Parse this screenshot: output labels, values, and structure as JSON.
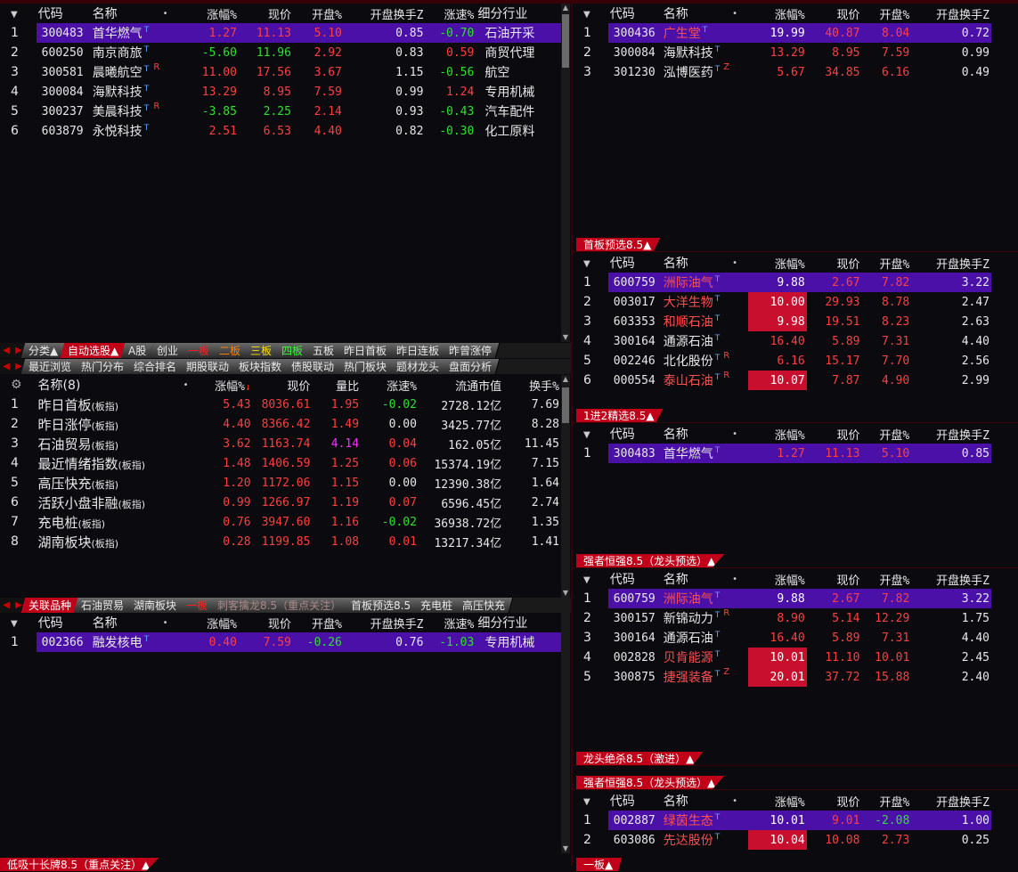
{
  "top_left": {
    "headers": [
      "代码",
      "名称",
      "•",
      "涨幅%",
      "现价",
      "开盘%",
      "开盘换手Z",
      "涨速%",
      "细分行业"
    ],
    "rows": [
      {
        "i": "1",
        "code": "300483",
        "name": "首华燃气",
        "tag": "",
        "chg": "1.27",
        "price": "11.13",
        "open": "5.10",
        "turn": "0.85",
        "speed": "-0.70",
        "ind": "石油开采",
        "cc": "up",
        "pc": "up",
        "oc": "up",
        "sc": "down",
        "sel": true
      },
      {
        "i": "2",
        "code": "600250",
        "name": "南京商旅",
        "tag": "",
        "chg": "-5.60",
        "price": "11.96",
        "open": "2.92",
        "turn": "0.83",
        "speed": "0.59",
        "ind": "商贸代理",
        "cc": "down",
        "pc": "down",
        "oc": "up",
        "sc": "up"
      },
      {
        "i": "3",
        "code": "300581",
        "name": "晨曦航空",
        "tag": "R",
        "chg": "11.00",
        "price": "17.56",
        "open": "3.67",
        "turn": "1.15",
        "speed": "-0.56",
        "ind": "航空",
        "cc": "up",
        "pc": "up",
        "oc": "up",
        "sc": "down"
      },
      {
        "i": "4",
        "code": "300084",
        "name": "海默科技",
        "tag": "",
        "chg": "13.29",
        "price": "8.95",
        "open": "7.59",
        "turn": "0.99",
        "speed": "1.24",
        "ind": "专用机械",
        "cc": "up",
        "pc": "up",
        "oc": "up",
        "sc": "up"
      },
      {
        "i": "5",
        "code": "300237",
        "name": "美晨科技",
        "tag": "R",
        "chg": "-3.85",
        "price": "2.25",
        "open": "2.14",
        "turn": "0.93",
        "speed": "-0.43",
        "ind": "汽车配件",
        "cc": "down",
        "pc": "down",
        "oc": "up",
        "sc": "down"
      },
      {
        "i": "6",
        "code": "603879",
        "name": "永悦科技",
        "tag": "",
        "chg": "2.51",
        "price": "6.53",
        "open": "4.40",
        "turn": "0.82",
        "speed": "-0.30",
        "ind": "化工原料",
        "cc": "up",
        "pc": "up",
        "oc": "up",
        "sc": "down"
      }
    ]
  },
  "tabs1": [
    "分类▲",
    "自动选股▲",
    "A股",
    "创业",
    "一板",
    "二板",
    "三板",
    "四板",
    "五板",
    "昨日首板",
    "昨日连板",
    "昨曾涨停"
  ],
  "tabs2": [
    "最近浏览",
    "热门分布",
    "综合排名",
    "期股联动",
    "板块指数",
    "债股联动",
    "热门板块",
    "题材龙头",
    "盘面分析"
  ],
  "sector": {
    "headers": [
      "名称(8)",
      "•",
      "涨幅%",
      "现价",
      "量比",
      "涨速%",
      "流通市值",
      "换手%"
    ],
    "suffix": "(板指)",
    "rows": [
      {
        "i": "1",
        "name": "昨日首板",
        "chg": "5.43",
        "price": "8036.61",
        "vr": "1.95",
        "speed": "-0.02",
        "mv": "2728.12亿",
        "turn": "7.69",
        "sc": "down",
        "vc": "up"
      },
      {
        "i": "2",
        "name": "昨日涨停",
        "chg": "4.40",
        "price": "8366.42",
        "vr": "1.49",
        "speed": "0.00",
        "mv": "3425.77亿",
        "turn": "8.28",
        "sc": "flat",
        "vc": "up"
      },
      {
        "i": "3",
        "name": "石油贸易",
        "chg": "3.62",
        "price": "1163.74",
        "vr": "4.14",
        "speed": "0.04",
        "mv": "162.05亿",
        "turn": "11.45",
        "sc": "up",
        "vc": "mag"
      },
      {
        "i": "4",
        "name": "最近情绪指数",
        "chg": "1.48",
        "price": "1406.59",
        "vr": "1.25",
        "speed": "0.06",
        "mv": "15374.19亿",
        "turn": "7.15",
        "sc": "up",
        "vc": "up"
      },
      {
        "i": "5",
        "name": "高压快充",
        "chg": "1.20",
        "price": "1172.06",
        "vr": "1.15",
        "speed": "0.00",
        "mv": "12390.38亿",
        "turn": "1.64",
        "sc": "flat",
        "vc": "up"
      },
      {
        "i": "6",
        "name": "活跃小盘非融",
        "chg": "0.99",
        "price": "1266.97",
        "vr": "1.19",
        "speed": "0.07",
        "mv": "6596.45亿",
        "turn": "2.74",
        "sc": "up",
        "vc": "up"
      },
      {
        "i": "7",
        "name": "充电桩",
        "chg": "0.76",
        "price": "3947.60",
        "vr": "1.16",
        "speed": "-0.02",
        "mv": "36938.72亿",
        "turn": "1.35",
        "sc": "down",
        "vc": "up"
      },
      {
        "i": "8",
        "name": "湖南板块",
        "chg": "0.28",
        "price": "1199.85",
        "vr": "1.08",
        "speed": "0.01",
        "mv": "13217.34亿",
        "turn": "1.41",
        "sc": "up",
        "vc": "up"
      }
    ]
  },
  "tabs3": [
    "关联品种",
    "石油贸易",
    "湖南板块",
    "一板",
    "刺客擒龙8.5（重点关注）",
    "首板预选8.5",
    "充电桩",
    "高压快充"
  ],
  "related": {
    "headers": [
      "代码",
      "名称",
      "•",
      "涨幅%",
      "现价",
      "开盘%",
      "开盘换手Z",
      "涨速%",
      "细分行业"
    ],
    "rows": [
      {
        "i": "1",
        "code": "002366",
        "name": "融发核电",
        "tag": "",
        "chg": "0.40",
        "price": "7.59",
        "open": "-0.26",
        "turn": "0.76",
        "speed": "-1.03",
        "ind": "专用机械",
        "cc": "up",
        "pc": "up",
        "oc": "down",
        "sc": "down",
        "sel": true
      }
    ]
  },
  "bottom_left_title": "低吸十长牌8.5（重点关注）▲",
  "right_headers": [
    "代码",
    "名称",
    "•",
    "涨幅%",
    "现价",
    "开盘%",
    "开盘换手Z"
  ],
  "r1": {
    "rows": [
      {
        "i": "1",
        "code": "300436",
        "name": "广生堂",
        "tag": "",
        "chg": "19.99",
        "price": "40.87",
        "open": "8.04",
        "turn": "0.72",
        "lim": true,
        "sel": true
      },
      {
        "i": "2",
        "code": "300084",
        "name": "海默科技",
        "tag": "",
        "chg": "13.29",
        "price": "8.95",
        "open": "7.59",
        "turn": "0.99"
      },
      {
        "i": "3",
        "code": "301230",
        "name": "泓博医药",
        "tag": "Z",
        "chg": "5.67",
        "price": "34.85",
        "open": "6.16",
        "turn": "0.49"
      }
    ]
  },
  "r2": {
    "title": "首板预选8.5▲",
    "rows": [
      {
        "i": "1",
        "code": "600759",
        "name": "洲际油气",
        "tag": "",
        "chg": "9.88",
        "price": "2.67",
        "open": "7.82",
        "turn": "3.22",
        "lim": true,
        "sel": true
      },
      {
        "i": "2",
        "code": "003017",
        "name": "大洋生物",
        "tag": "",
        "chg": "10.00",
        "price": "29.93",
        "open": "8.78",
        "turn": "2.47",
        "lim": true
      },
      {
        "i": "3",
        "code": "603353",
        "name": "和顺石油",
        "tag": "",
        "chg": "9.98",
        "price": "19.51",
        "open": "8.23",
        "turn": "2.63",
        "lim": true
      },
      {
        "i": "4",
        "code": "300164",
        "name": "通源石油",
        "tag": "",
        "chg": "16.40",
        "price": "5.89",
        "open": "7.31",
        "turn": "4.40"
      },
      {
        "i": "5",
        "code": "002246",
        "name": "北化股份",
        "tag": "R",
        "chg": "6.16",
        "price": "15.17",
        "open": "7.70",
        "turn": "2.56"
      },
      {
        "i": "6",
        "code": "000554",
        "name": "泰山石油",
        "tag": "R",
        "chg": "10.07",
        "price": "7.87",
        "open": "4.90",
        "turn": "2.99",
        "lim": true
      }
    ]
  },
  "r3": {
    "title": "1进2精选8.5▲",
    "rows": [
      {
        "i": "1",
        "code": "300483",
        "name": "首华燃气",
        "tag": "",
        "chg": "1.27",
        "price": "11.13",
        "open": "5.10",
        "turn": "0.85",
        "sel": true
      }
    ]
  },
  "r4": {
    "title": "强者恒强8.5（龙头预选）▲",
    "rows": [
      {
        "i": "1",
        "code": "600759",
        "name": "洲际油气",
        "tag": "",
        "chg": "9.88",
        "price": "2.67",
        "open": "7.82",
        "turn": "3.22",
        "lim": true,
        "sel": true
      },
      {
        "i": "2",
        "code": "300157",
        "name": "新锦动力",
        "tag": "R",
        "chg": "8.90",
        "price": "5.14",
        "open": "12.29",
        "turn": "1.75"
      },
      {
        "i": "3",
        "code": "300164",
        "name": "通源石油",
        "tag": "",
        "chg": "16.40",
        "price": "5.89",
        "open": "7.31",
        "turn": "4.40"
      },
      {
        "i": "4",
        "code": "002828",
        "name": "贝肯能源",
        "tag": "",
        "chg": "10.01",
        "price": "11.10",
        "open": "10.01",
        "turn": "2.45",
        "lim": true
      },
      {
        "i": "5",
        "code": "300875",
        "name": "捷强装备",
        "tag": "Z",
        "chg": "20.01",
        "price": "37.72",
        "open": "15.88",
        "turn": "2.40",
        "lim": true
      }
    ]
  },
  "r5": {
    "title": "龙头绝杀8.5（激进）▲"
  },
  "r6": {
    "title": "强者恒强8.5（龙头预选）▲",
    "rows": [
      {
        "i": "1",
        "code": "002887",
        "name": "绿茵生态",
        "tag": "",
        "chg": "10.01",
        "price": "9.01",
        "open": "-2.08",
        "turn": "1.00",
        "lim": true,
        "sel": true
      },
      {
        "i": "2",
        "code": "603086",
        "name": "先达股份",
        "tag": "",
        "chg": "10.04",
        "price": "10.08",
        "open": "2.73",
        "turn": "0.25",
        "lim": true
      }
    ]
  },
  "r7": {
    "title": "一板▲"
  }
}
